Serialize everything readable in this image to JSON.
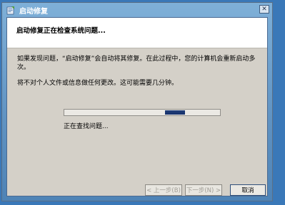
{
  "window": {
    "title": "启动修复",
    "close_label": "✕"
  },
  "header": {
    "title": "启动修复正在检查系统问题..."
  },
  "content": {
    "paragraph1": "如果发现问题，“启动修复”会自动将其修复。在此过程中，您的计算机会重新启动多次。",
    "paragraph2": "将不对个人文件或信息做任何更改。这可能需要几分钟。"
  },
  "progress": {
    "status_text": "正在查找问题...",
    "position_fraction": 0.74
  },
  "buttons": {
    "back_label": "< 上一步(B)",
    "next_label": "下一步(N) >",
    "cancel_label": "取消"
  },
  "colors": {
    "desktop": "#3a78b8",
    "client": "#d4d0c8",
    "progress_chunk": "#1a3570"
  }
}
